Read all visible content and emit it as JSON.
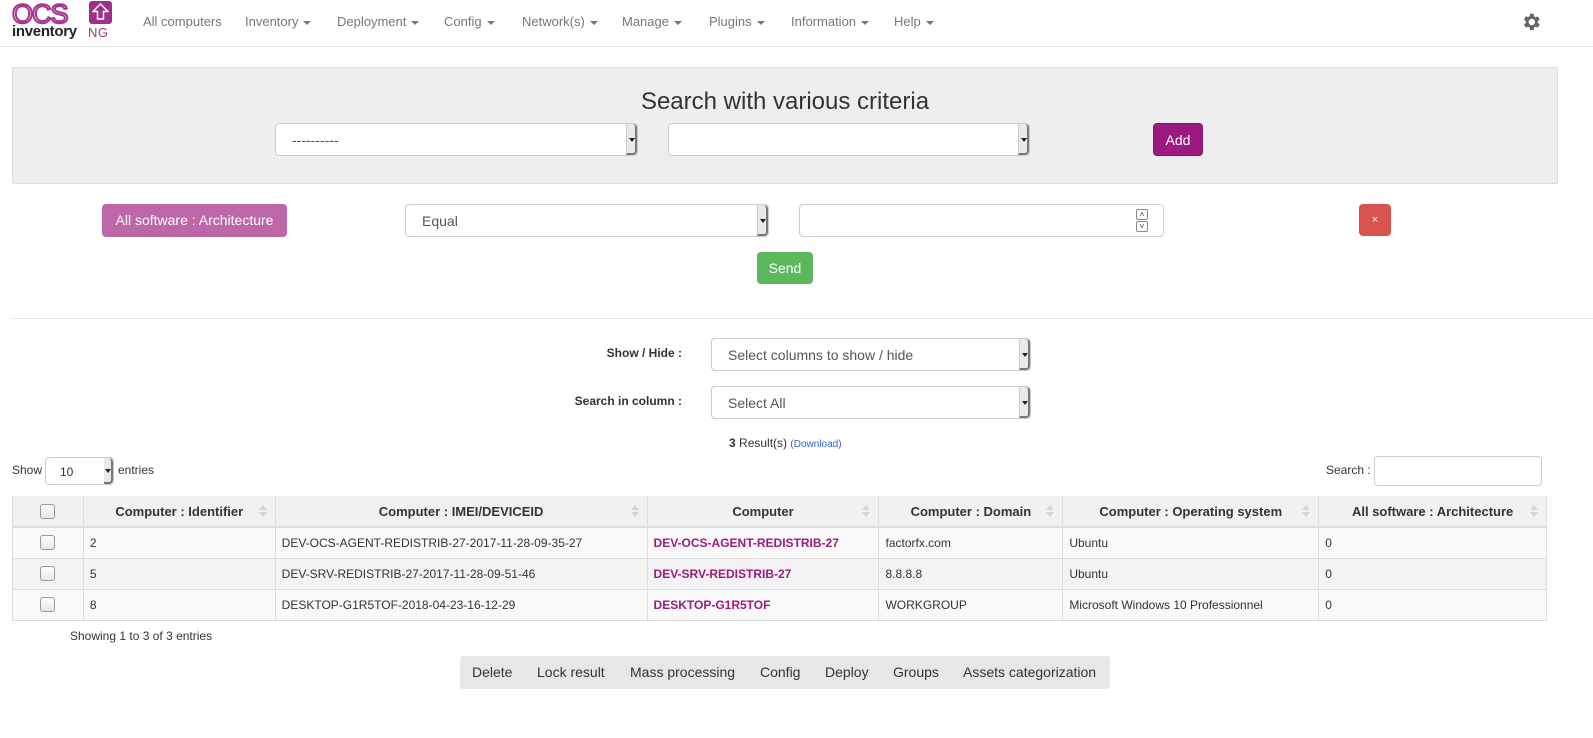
{
  "app": {
    "logo_top": "OCS",
    "logo_bottom": "inventory",
    "logo_suffix": "NG"
  },
  "nav": {
    "items": [
      {
        "label": "All computers",
        "dropdown": false
      },
      {
        "label": "Inventory",
        "dropdown": true
      },
      {
        "label": "Deployment",
        "dropdown": true
      },
      {
        "label": "Config",
        "dropdown": true
      },
      {
        "label": "Network(s)",
        "dropdown": true
      },
      {
        "label": "Manage",
        "dropdown": true
      },
      {
        "label": "Plugins",
        "dropdown": true
      },
      {
        "label": "Information",
        "dropdown": true
      },
      {
        "label": "Help",
        "dropdown": true
      }
    ],
    "settings_icon": "gear-icon"
  },
  "search_panel": {
    "title": "Search with various criteria",
    "field_select_value": "----------",
    "subfield_select_value": "",
    "add_label": "Add"
  },
  "criterion": {
    "field_label": "All software : Architecture",
    "operator_value": "Equal",
    "value": "",
    "remove_label": "×",
    "send_label": "Send"
  },
  "columns_controls": {
    "show_hide_label": "Show / Hide :",
    "show_hide_placeholder": "Select columns to show / hide",
    "search_in_column_label": "Search in column :",
    "search_in_column_value": "Select All",
    "result_count": "3",
    "result_suffix": "Result(s)",
    "download_label": "(Download)"
  },
  "table_controls": {
    "show_label": "Show",
    "page_size": "10",
    "entries_label": "entries",
    "search_label": "Search :",
    "search_value": ""
  },
  "table": {
    "columns": [
      "Computer : Identifier",
      "Computer : IMEI/DEVICEID",
      "Computer",
      "Computer : Domain",
      "Computer : Operating system",
      "All software : Architecture"
    ],
    "rows": [
      {
        "id": "2",
        "deviceid": "DEV-OCS-AGENT-REDISTRIB-27-2017-11-28-09-35-27",
        "computer": "DEV-OCS-AGENT-REDISTRIB-27",
        "domain": "factorfx.com",
        "os": "Ubuntu",
        "arch": "0"
      },
      {
        "id": "5",
        "deviceid": "DEV-SRV-REDISTRIB-27-2017-11-28-09-51-46",
        "computer": "DEV-SRV-REDISTRIB-27",
        "domain": "8.8.8.8",
        "os": "Ubuntu",
        "arch": "0"
      },
      {
        "id": "8",
        "deviceid": "DESKTOP-G1R5TOF-2018-04-23-16-12-29",
        "computer": "DESKTOP-G1R5TOF",
        "domain": "WORKGROUP",
        "os": "Microsoft Windows 10 Professionnel",
        "arch": "0"
      }
    ],
    "info": "Showing 1 to 3 of 3 entries"
  },
  "actions": [
    "Delete",
    "Lock result",
    "Mass processing",
    "Config",
    "Deploy",
    "Groups",
    "Assets categorization"
  ],
  "colors": {
    "brand": "#9c1a7f",
    "criterion": "#bd67a9",
    "send": "#5cb85c",
    "remove": "#d9534f",
    "link": "#9b1b7f"
  }
}
